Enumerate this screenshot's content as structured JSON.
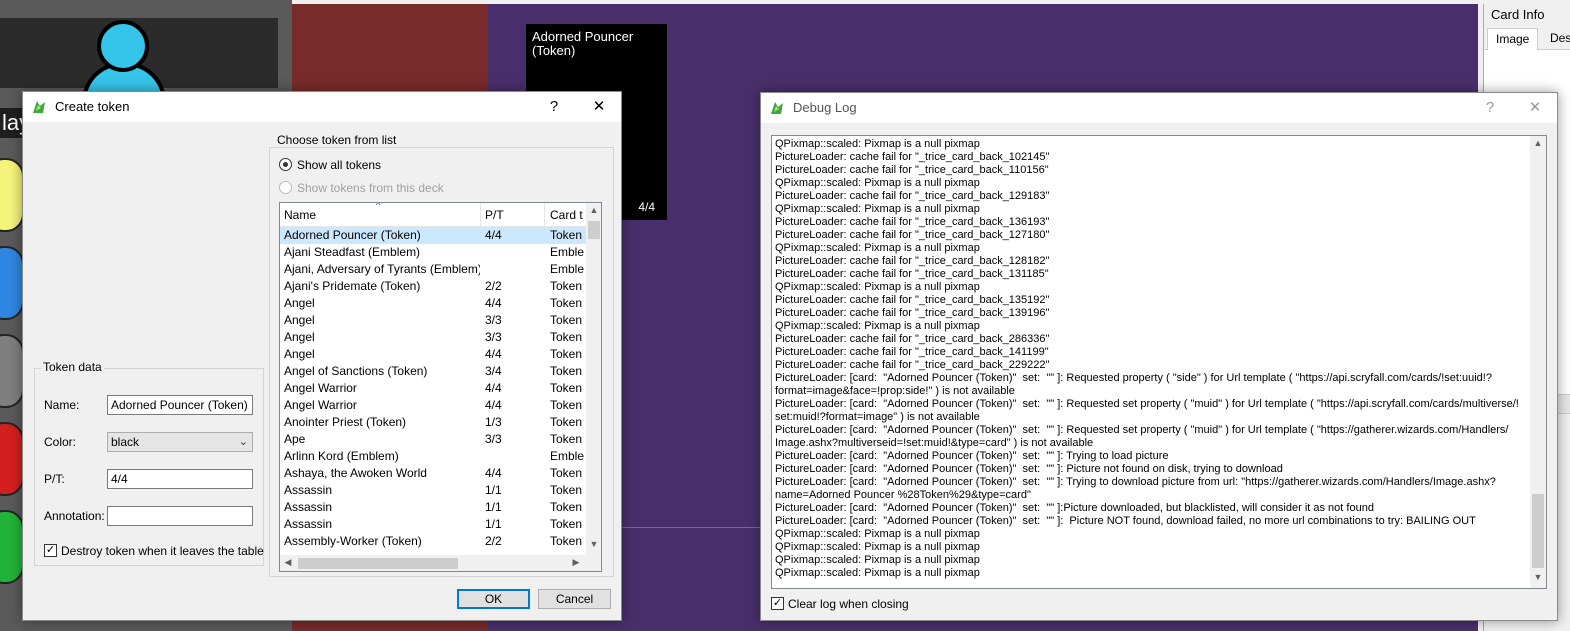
{
  "background": {
    "player_label": "lay",
    "card_preview": {
      "title": "Adorned Pouncer (Token)",
      "pt": "4/4"
    },
    "colors": {
      "left": "#5a5a5a",
      "red": "#782b2b",
      "purple": "#482f6b",
      "avatar": "#36c5ea"
    },
    "mana_colors": [
      "#f4f37a",
      "#2f86e0",
      "#7f7f7f",
      "#d31f1f",
      "#21b33a"
    ]
  },
  "card_info": {
    "title": "Card Info",
    "tabs": [
      "Image",
      "Des"
    ]
  },
  "create_token": {
    "title": "Create token",
    "help": "?",
    "close": "✕",
    "token_data": {
      "legend": "Token data",
      "name_label": "Name:",
      "name_value": "Adorned Pouncer (Token)",
      "color_label": "Color:",
      "color_value": "black",
      "pt_label": "P/T:",
      "pt_value": "4/4",
      "annotation_label": "Annotation:",
      "annotation_value": "",
      "destroy_label": "Destroy token when it leaves the table",
      "destroy_checked": true
    },
    "choose": {
      "legend": "Choose token from list",
      "show_all": "Show all tokens",
      "show_deck": "Show tokens from this deck"
    },
    "table": {
      "headers": [
        "Name",
        "P/T",
        "Card t"
      ],
      "rows": [
        {
          "name": "Adorned Pouncer (Token)",
          "pt": "4/4",
          "type": "Token",
          "selected": true
        },
        {
          "name": "Ajani Steadfast (Emblem)",
          "pt": "",
          "type": "Emble"
        },
        {
          "name": "Ajani, Adversary of Tyrants (Emblem)",
          "pt": "",
          "type": "Emble"
        },
        {
          "name": "Ajani's Pridemate (Token)",
          "pt": "2/2",
          "type": "Token"
        },
        {
          "name": "Angel",
          "pt": "4/4",
          "type": "Token"
        },
        {
          "name": "Angel",
          "pt": "3/3",
          "type": "Token"
        },
        {
          "name": "Angel",
          "pt": "3/3",
          "type": "Token"
        },
        {
          "name": "Angel",
          "pt": "4/4",
          "type": "Token"
        },
        {
          "name": "Angel of Sanctions (Token)",
          "pt": "3/4",
          "type": "Token"
        },
        {
          "name": "Angel Warrior",
          "pt": "4/4",
          "type": "Token"
        },
        {
          "name": "Angel Warrior",
          "pt": "4/4",
          "type": "Token"
        },
        {
          "name": "Anointer Priest (Token)",
          "pt": "1/3",
          "type": "Token"
        },
        {
          "name": "Ape",
          "pt": "3/3",
          "type": "Token"
        },
        {
          "name": "Arlinn Kord (Emblem)",
          "pt": "",
          "type": "Emble"
        },
        {
          "name": "Ashaya, the Awoken World",
          "pt": "4/4",
          "type": "Token"
        },
        {
          "name": "Assassin",
          "pt": "1/1",
          "type": "Token"
        },
        {
          "name": "Assassin",
          "pt": "1/1",
          "type": "Token"
        },
        {
          "name": "Assassin",
          "pt": "1/1",
          "type": "Token"
        },
        {
          "name": "Assembly-Worker (Token)",
          "pt": "2/2",
          "type": "Token"
        }
      ]
    },
    "ok": "OK",
    "cancel": "Cancel"
  },
  "debug_log": {
    "title": "Debug Log",
    "help": "?",
    "close": "✕",
    "lines": [
      "QPixmap::scaled: Pixmap is a null pixmap",
      "PictureLoader: cache fail for \"_trice_card_back_102145\"",
      "PictureLoader: cache fail for \"_trice_card_back_110156\"",
      "QPixmap::scaled: Pixmap is a null pixmap",
      "PictureLoader: cache fail for \"_trice_card_back_129183\"",
      "QPixmap::scaled: Pixmap is a null pixmap",
      "PictureLoader: cache fail for \"_trice_card_back_136193\"",
      "PictureLoader: cache fail for \"_trice_card_back_127180\"",
      "QPixmap::scaled: Pixmap is a null pixmap",
      "PictureLoader: cache fail for \"_trice_card_back_128182\"",
      "PictureLoader: cache fail for \"_trice_card_back_131185\"",
      "QPixmap::scaled: Pixmap is a null pixmap",
      "PictureLoader: cache fail for \"_trice_card_back_135192\"",
      "PictureLoader: cache fail for \"_trice_card_back_139196\"",
      "QPixmap::scaled: Pixmap is a null pixmap",
      "PictureLoader: cache fail for \"_trice_card_back_286336\"",
      "PictureLoader: cache fail for \"_trice_card_back_141199\"",
      "PictureLoader: cache fail for \"_trice_card_back_229222\"",
      "PictureLoader: [card:  \"Adorned Pouncer (Token)\"  set:  \"\" ]: Requested property ( \"side\" ) for Url template ( \"https://api.scryfall.com/cards/!set:uuid!?\nformat=image&face=!prop:side!\" ) is not available",
      "PictureLoader: [card:  \"Adorned Pouncer (Token)\"  set:  \"\" ]: Requested set property ( \"muid\" ) for Url template ( \"https://api.scryfall.com/cards/multiverse/!\nset:muid!?format=image\" ) is not available",
      "PictureLoader: [card:  \"Adorned Pouncer (Token)\"  set:  \"\" ]: Requested set property ( \"muid\" ) for Url template ( \"https://gatherer.wizards.com/Handlers/\nImage.ashx?multiverseid=!set:muid!&type=card\" ) is not available",
      "PictureLoader: [card:  \"Adorned Pouncer (Token)\"  set:  \"\" ]: Trying to load picture",
      "PictureLoader: [card:  \"Adorned Pouncer (Token)\"  set:  \"\" ]: Picture not found on disk, trying to download",
      "PictureLoader: [card:  \"Adorned Pouncer (Token)\"  set:  \"\" ]: Trying to download picture from url: \"https://gatherer.wizards.com/Handlers/Image.ashx?\nname=Adorned Pouncer %28Token%29&type=card\"",
      "PictureLoader: [card:  \"Adorned Pouncer (Token)\"  set:  \"\" ]:Picture downloaded, but blacklisted, will consider it as not found",
      "PictureLoader: [card:  \"Adorned Pouncer (Token)\"  set:  \"\" ]:  Picture NOT found, download failed, no more url combinations to try: BAILING OUT",
      "QPixmap::scaled: Pixmap is a null pixmap",
      "QPixmap::scaled: Pixmap is a null pixmap",
      "QPixmap::scaled: Pixmap is a null pixmap",
      "QPixmap::scaled: Pixmap is a null pixmap"
    ],
    "clear_on_close_label": "Clear log when closing",
    "clear_on_close_checked": true
  }
}
